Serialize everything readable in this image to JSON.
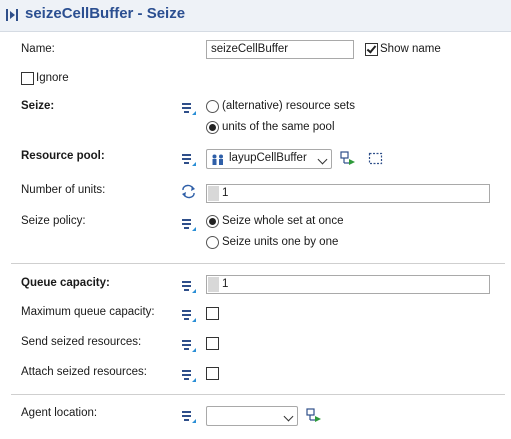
{
  "title": "seizeCellBuffer - Seize",
  "fields": {
    "name": {
      "label": "Name:",
      "value": "seizeCellBuffer",
      "show_name_label": "Show name",
      "show_name": true
    },
    "ignore": {
      "label": "Ignore",
      "checked": false
    },
    "seize": {
      "label": "Seize:",
      "options": [
        "(alternative) resource sets",
        "units of the same pool"
      ],
      "selected": 1
    },
    "resource_pool": {
      "label": "Resource pool:",
      "value": "layupCellBuffer"
    },
    "number_of_units": {
      "label": "Number of units:",
      "value": "1"
    },
    "seize_policy": {
      "label": "Seize policy:",
      "options": [
        "Seize whole set at once",
        "Seize units one by one"
      ],
      "selected": 0
    },
    "queue_capacity": {
      "label": "Queue capacity:",
      "value": "1"
    },
    "max_queue_capacity": {
      "label": "Maximum queue capacity:",
      "checked": false
    },
    "send_seized": {
      "label": "Send seized resources:",
      "checked": false
    },
    "attach_seized": {
      "label": "Attach seized resources:",
      "checked": false
    },
    "agent_location": {
      "label": "Agent location:",
      "value": ""
    }
  },
  "colors": {
    "title": "#2b4f91",
    "header_bg": "#eef2f7",
    "equation_icon": "#2f4f8a"
  }
}
